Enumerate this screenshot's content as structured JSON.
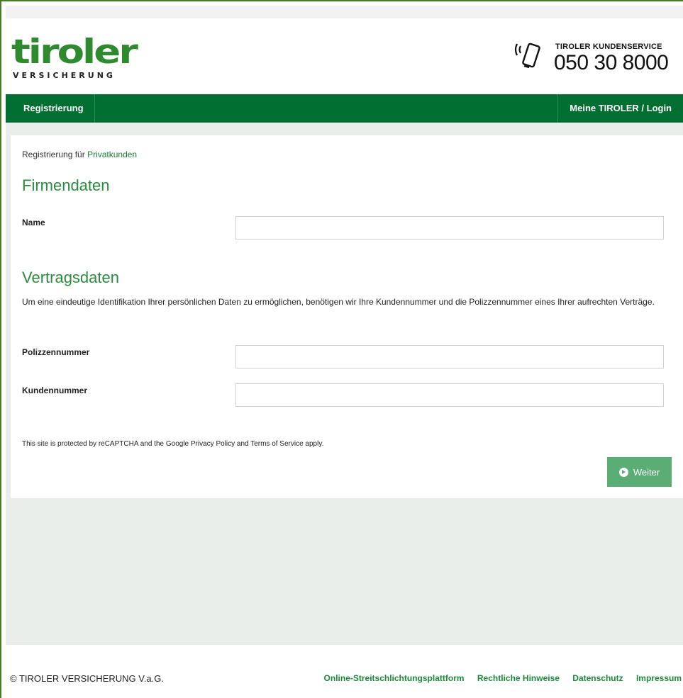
{
  "brand": {
    "logo_word": "tiroler",
    "logo_sub": "VERSICHERUNG",
    "service_label": "TIROLER KUNDENSERVICE",
    "service_number": "050 30 8000",
    "accent_color": "#006f31",
    "link_color": "#1a7d3a"
  },
  "nav": {
    "left_label": "Registrierung",
    "right_label": "Meine TIROLER / Login"
  },
  "breadcrumb": {
    "prefix": "Registrierung für",
    "link": "Privatkunden"
  },
  "firmendaten": {
    "heading": "Firmendaten",
    "name_label": "Name",
    "name_value": ""
  },
  "vertragsdaten": {
    "heading": "Vertragsdaten",
    "description": "Um eine eindeutige Identifikation Ihrer persönlichen Daten zu ermöglichen, benötigen wir Ihre Kundennummer und die Polizzennummer eines Ihrer aufrechten Verträge.",
    "polizzennummer_label": "Polizzennummer",
    "polizzennummer_value": "",
    "kundennummer_label": "Kundennummer",
    "kundennummer_value": ""
  },
  "recaptcha_notice": "This site is protected by reCAPTCHA and the Google Privacy Policy and Terms of Service apply.",
  "weiter_button": {
    "label": "Weiter",
    "icon": "chevron-circle-right-icon"
  },
  "footer": {
    "copyright": "© TIROLER VERSICHERUNG V.a.G.",
    "links": [
      "Online-Streitschlichtungsplattform",
      "Rechtliche Hinweise",
      "Datenschutz",
      "Impressum"
    ]
  }
}
